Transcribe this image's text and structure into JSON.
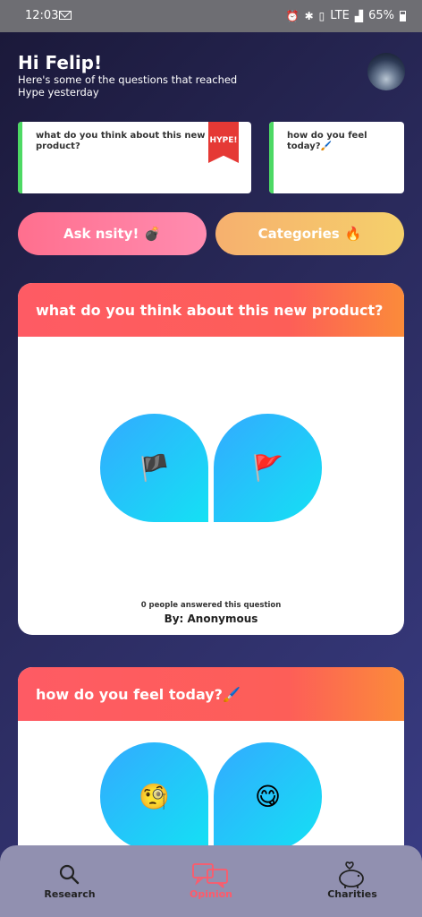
{
  "status": {
    "time": "12:03",
    "network": "LTE",
    "battery": "65%"
  },
  "header": {
    "greeting": "Hi Felip!",
    "subtitle": "Here's some of the questions that reached Hype yesterday"
  },
  "hype_cards": [
    {
      "question": "what do you think about this new product?",
      "badge": "HYPE!"
    },
    {
      "question": "how do you feel today?🖌️"
    }
  ],
  "actions": {
    "ask_label": "Ask nsity!",
    "ask_emoji": "💣",
    "categories_label": "Categories",
    "categories_emoji": "🔥"
  },
  "questions": [
    {
      "title": "what do you think about this new product?",
      "option_left": "🏴",
      "option_right": "🚩",
      "answered": "0 people answered this question",
      "author": "By: Anonymous"
    },
    {
      "title": "how do you feel today?🖌️",
      "option_left": "🧐",
      "option_right": "😋"
    }
  ],
  "nav": [
    {
      "label": "Research",
      "icon": "search-icon"
    },
    {
      "label": "Opinion",
      "icon": "chat-bubbles-icon",
      "active": true
    },
    {
      "label": "Charities",
      "icon": "piggy-bank-icon"
    }
  ],
  "colors": {
    "accent": "#ff5a6a",
    "hype_bar": "#4dd964",
    "choice_from": "#33aaff",
    "choice_to": "#14e1f4"
  }
}
